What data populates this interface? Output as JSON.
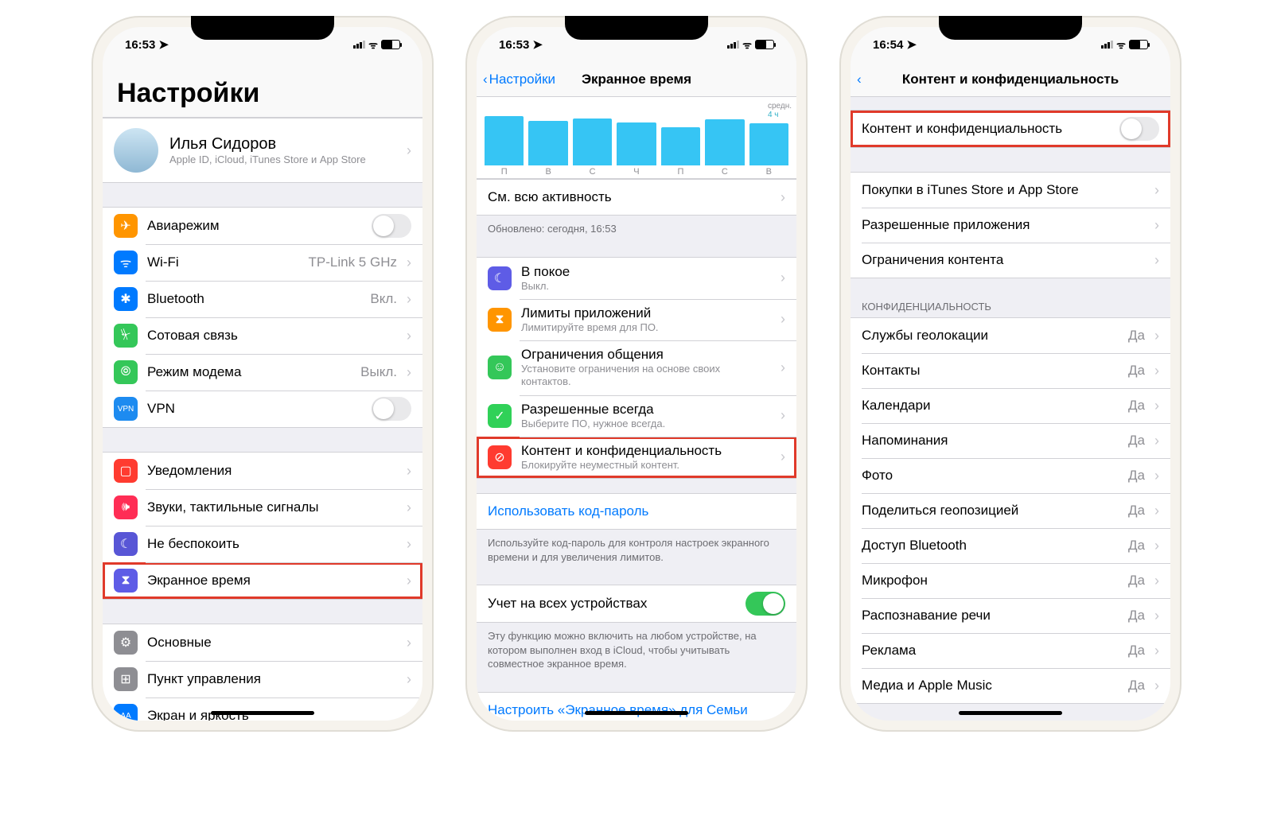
{
  "colors": {
    "orange": "#ff9500",
    "blue": "#007aff",
    "green": "#34c759",
    "lime": "#30d158",
    "red": "#ff3b30",
    "pink": "#ff2d55",
    "purple": "#5856d6",
    "gray": "#8e8e93",
    "teal": "#30b0c7",
    "indigo": "#5e5ce6",
    "cyan": "#32ade6",
    "darkgreen": "#00c7be",
    "yellow": "#ffcc00",
    "vpnblue": "#1d8bf0",
    "grayicon": "#8e8e93",
    "blueA": "#0a84ff"
  },
  "phone1": {
    "time": "16:53",
    "title": "Настройки",
    "profile": {
      "name": "Илья Сидоров",
      "sub": "Apple ID, iCloud, iTunes Store и App Store"
    },
    "group1": [
      {
        "icon": "✈",
        "bg": "orange",
        "title": "Авиарежим",
        "toggle": false
      },
      {
        "icon": "ᯤ",
        "bg": "blue",
        "title": "Wi-Fi",
        "detail": "TP-Link 5 GHz"
      },
      {
        "icon": "✱",
        "bg": "blue",
        "title": "Bluetooth",
        "detail": "Вкл."
      },
      {
        "icon": "⏧",
        "bg": "green",
        "title": "Сотовая связь",
        "detail": ""
      },
      {
        "icon": "⦾",
        "bg": "green",
        "title": "Режим модема",
        "detail": "Выкл."
      },
      {
        "icon": "VPN",
        "bg": "vpnblue",
        "title": "VPN",
        "toggle": false,
        "small": true
      }
    ],
    "group2": [
      {
        "icon": "▢",
        "bg": "red",
        "title": "Уведомления"
      },
      {
        "icon": "🕪",
        "bg": "pink",
        "title": "Звуки, тактильные сигналы"
      },
      {
        "icon": "☾",
        "bg": "purple",
        "title": "Не беспокоить"
      },
      {
        "icon": "⧗",
        "bg": "indigo",
        "title": "Экранное время",
        "hl": true
      }
    ],
    "group3": [
      {
        "icon": "⚙",
        "bg": "gray",
        "title": "Основные"
      },
      {
        "icon": "⊞",
        "bg": "gray",
        "title": "Пункт управления"
      },
      {
        "icon": "AA",
        "bg": "blue",
        "title": "Экран и яркость",
        "small": true
      }
    ]
  },
  "phone2": {
    "time": "16:53",
    "back": "Настройки",
    "title": "Экранное время",
    "chart": {
      "side_top": "средн.",
      "side_val": "4 ч",
      "days": [
        "П",
        "В",
        "С",
        "Ч",
        "П",
        "С",
        "В"
      ],
      "bars": [
        78,
        70,
        74,
        68,
        60,
        72,
        66
      ]
    },
    "activity": "См. всю активность",
    "updated": "Обновлено: сегодня, 16:53",
    "items": [
      {
        "icon": "☾",
        "bg": "indigo",
        "title": "В покое",
        "sub": "Выкл."
      },
      {
        "icon": "⧗",
        "bg": "orange",
        "title": "Лимиты приложений",
        "sub": "Лимитируйте время для ПО."
      },
      {
        "icon": "☺",
        "bg": "green",
        "title": "Ограничения общения",
        "sub": "Установите ограничения на основе своих контактов."
      },
      {
        "icon": "✓",
        "bg": "lime",
        "title": "Разрешенные всегда",
        "sub": "Выберите ПО, нужное всегда."
      },
      {
        "icon": "⊘",
        "bg": "red",
        "title": "Контент и конфиденциальность",
        "sub": "Блокируйте неуместный контент.",
        "hl": true
      }
    ],
    "passcode": "Использовать код-пароль",
    "passcode_foot": "Используйте код-пароль для контроля настроек экранного времени и для увеличения лимитов.",
    "share": "Учет на всех устройствах",
    "share_on": true,
    "share_foot": "Эту функцию можно включить на любом устройстве, на котором выполнен вход в iCloud, чтобы учитывать совместное экранное время.",
    "family": "Настроить «Экранное время» для Семьи"
  },
  "phone3": {
    "time": "16:54",
    "title": "Контент и конфиденциальность",
    "main_toggle": {
      "label": "Контент и конфиденциальность",
      "on": false,
      "hl": true
    },
    "rows1": [
      {
        "title": "Покупки в iTunes Store и App Store"
      },
      {
        "title": "Разрешенные приложения"
      },
      {
        "title": "Ограничения контента"
      }
    ],
    "privacy_header": "КОНФИДЕНЦИАЛЬНОСТЬ",
    "rows2": [
      {
        "title": "Службы геолокации",
        "detail": "Да"
      },
      {
        "title": "Контакты",
        "detail": "Да"
      },
      {
        "title": "Календари",
        "detail": "Да"
      },
      {
        "title": "Напоминания",
        "detail": "Да"
      },
      {
        "title": "Фото",
        "detail": "Да"
      },
      {
        "title": "Поделиться геопозицией",
        "detail": "Да"
      },
      {
        "title": "Доступ Bluetooth",
        "detail": "Да"
      },
      {
        "title": "Микрофон",
        "detail": "Да"
      },
      {
        "title": "Распознавание речи",
        "detail": "Да"
      },
      {
        "title": "Реклама",
        "detail": "Да"
      },
      {
        "title": "Медиа и Apple Music",
        "detail": "Да"
      }
    ]
  },
  "chart_data": {
    "type": "bar",
    "title": "Экранное время — средн. 4 ч",
    "categories": [
      "П",
      "В",
      "С",
      "Ч",
      "П",
      "С",
      "В"
    ],
    "values": [
      78,
      70,
      74,
      68,
      60,
      72,
      66
    ],
    "ylim": [
      0,
      100
    ],
    "note": "values are relative bar heights (percent of max); axis shows average ≈ 4 h"
  }
}
